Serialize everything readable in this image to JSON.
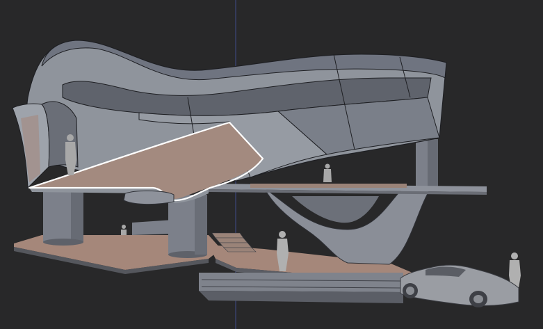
{
  "viewport": {
    "background": "#282829",
    "axis_color": "#3f4d8c",
    "selection_outline_color": "#ffffff"
  },
  "materials": {
    "shell_light": "#8f949c",
    "shell_mid": "#6f7480",
    "shell_dark": "#565a63",
    "floor_wood": "#a5877a",
    "floor_edge": "#8a8d94",
    "column": "#7c808a",
    "figure": "#a8a8a8",
    "car": "#9a9da3"
  },
  "scene": {
    "figures_count": 5,
    "has_car": true,
    "selected_object": "cantilever-slab"
  }
}
